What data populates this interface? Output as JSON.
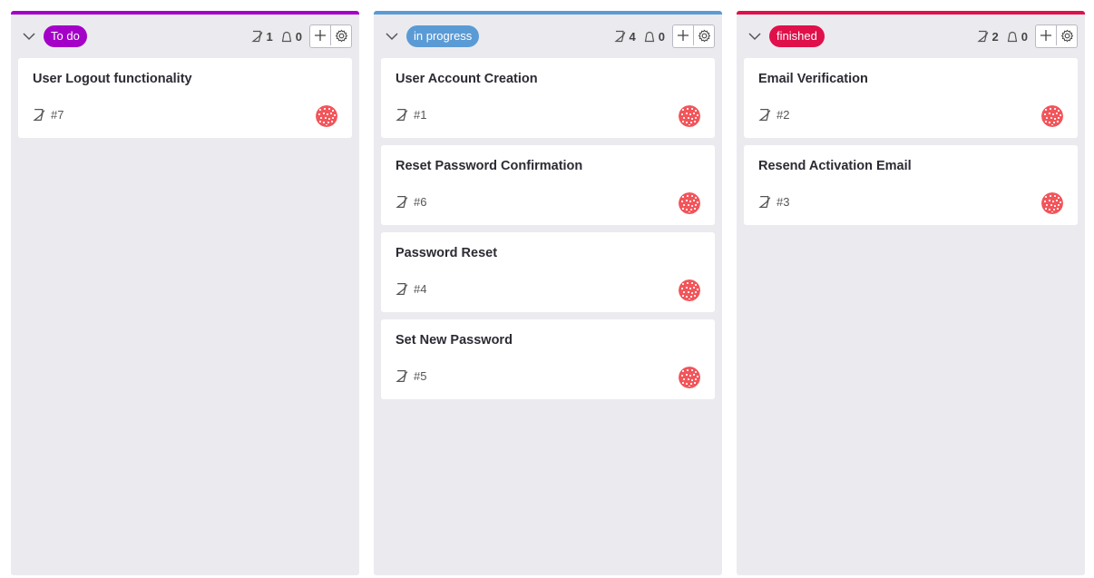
{
  "columns": [
    {
      "label": "To do",
      "accent": "#a400c8",
      "story_count": "1",
      "task_count": "0",
      "cards": [
        {
          "title": "User Logout functionality",
          "ref": "#7"
        }
      ]
    },
    {
      "label": "in progress",
      "accent": "#5b9bd5",
      "story_count": "4",
      "task_count": "0",
      "cards": [
        {
          "title": "User Account Creation",
          "ref": "#1"
        },
        {
          "title": "Reset Password Confirmation",
          "ref": "#6"
        },
        {
          "title": "Password Reset",
          "ref": "#4"
        },
        {
          "title": "Set New Password",
          "ref": "#5"
        }
      ]
    },
    {
      "label": "finished",
      "accent": "#e0104a",
      "story_count": "2",
      "task_count": "0",
      "cards": [
        {
          "title": "Email Verification",
          "ref": "#2"
        },
        {
          "title": "Resend Activation Email",
          "ref": "#3"
        }
      ]
    }
  ],
  "icons": {
    "collapse": "chevron-down-icon",
    "story": "user-story-icon",
    "task": "task-icon",
    "add": "plus-icon",
    "settings": "gear-icon",
    "avatar": "user-avatar"
  },
  "colors": {
    "column_bg": "#ebebef",
    "avatar": "#f2555a"
  }
}
